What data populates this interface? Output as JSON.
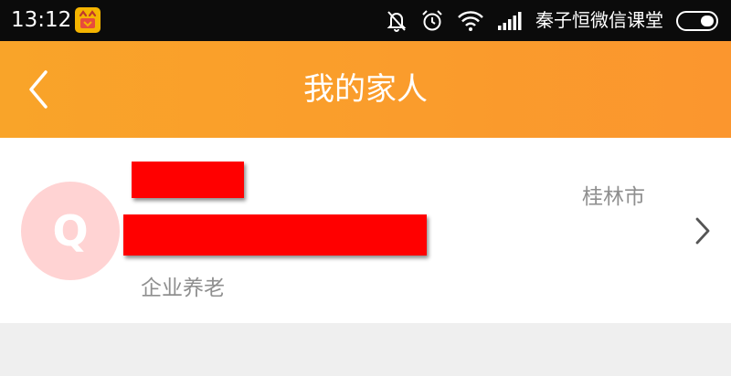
{
  "status_bar": {
    "time": "13:12",
    "carrier": "秦子恒微信课堂",
    "icons": [
      "app-notification-icon",
      "mute-bell-icon",
      "alarm-icon",
      "wifi-icon",
      "signal-icon",
      "battery-icon"
    ]
  },
  "header": {
    "title": "我的家人",
    "back_icon": "back-arrow-icon"
  },
  "family_member": {
    "avatar_initial": "Q",
    "tag": "企业养老",
    "city": "桂林市",
    "chevron_icon": "chevron-right-icon"
  },
  "colors": {
    "header_start": "#f9a429",
    "header_end": "#fb962e",
    "avatar_bg": "#ffd3d3",
    "redaction": "#ff0000",
    "muted_text": "#8f8f8f"
  }
}
